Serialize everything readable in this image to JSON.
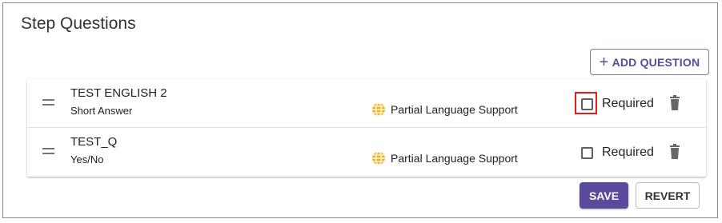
{
  "section": {
    "title": "Step Questions"
  },
  "toolbar": {
    "add_question_label": "ADD QUESTION",
    "add_icon": "plus-icon"
  },
  "questions": [
    {
      "name": "TEST ENGLISH 2",
      "type": "Short Answer",
      "language_support": "Partial Language Support",
      "required_label": "Required",
      "required": false,
      "highlighted": true
    },
    {
      "name": "TEST_Q",
      "type": "Yes/No",
      "language_support": "Partial Language Support",
      "required_label": "Required",
      "required": false,
      "highlighted": false
    }
  ],
  "actions": {
    "save_label": "SAVE",
    "revert_label": "REVERT"
  },
  "colors": {
    "accent": "#5b4a9c",
    "globe": "#f0b41e",
    "highlight": "#e21b1b"
  }
}
